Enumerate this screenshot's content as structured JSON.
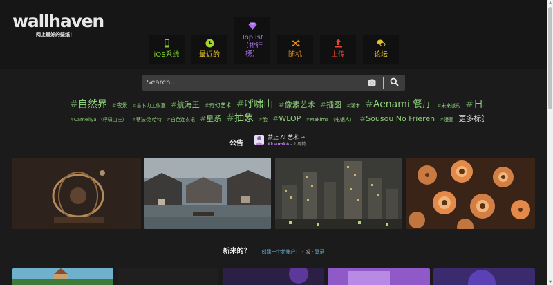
{
  "logo": {
    "text": "wallhaven",
    "tagline": "网上最好的壁纸！"
  },
  "nav": [
    {
      "label": "iOS系统",
      "icon": "phone-icon",
      "color": "#7fcf2f"
    },
    {
      "label": "最近的",
      "icon": "clock-icon",
      "color": "#e2c12c"
    },
    {
      "label": "Toplist\n（排行\n榜）",
      "icon": "gem-icon",
      "color": "#a971f0"
    },
    {
      "label": "随机",
      "icon": "shuffle-icon",
      "color": "#e9902c"
    },
    {
      "label": "上传",
      "icon": "upload-icon",
      "color": "#e5472f"
    },
    {
      "label": "论坛",
      "icon": "chat-icon",
      "color": "#e2c12c"
    }
  ],
  "search": {
    "placeholder": "Search...",
    "value": ""
  },
  "tags_row1": [
    {
      "text": "自然界",
      "size": "s1"
    },
    {
      "text": "夜景",
      "size": "s3"
    },
    {
      "text": "吉卜力工作室",
      "size": "s4"
    },
    {
      "text": "航海王",
      "size": "s2"
    },
    {
      "text": "奇幻艺术",
      "size": "s3"
    },
    {
      "text": "呼啸山",
      "size": "s1"
    },
    {
      "text": "像素艺术",
      "size": "s2"
    },
    {
      "text": "插图",
      "size": "s2"
    },
    {
      "text": "灌木",
      "size": "s4"
    },
    {
      "text": "Aenami 餐厅",
      "size": "s1"
    },
    {
      "text": "未来派的",
      "size": "s4"
    },
    {
      "text": "日本",
      "size": "s1"
    }
  ],
  "tags_row2": [
    {
      "text": "Camellya （呼啸山庄）",
      "size": "s4"
    },
    {
      "text": "蒂法·洛哈特",
      "size": "s4"
    },
    {
      "text": "白色连衣裙",
      "size": "s4"
    },
    {
      "text": "星系",
      "size": "s2"
    },
    {
      "text": "抽象",
      "size": "s1"
    },
    {
      "text": "脸",
      "size": "s4"
    },
    {
      "text": "WLOP",
      "size": "s2"
    },
    {
      "text": "Makima （电锯人）",
      "size": "s4"
    },
    {
      "text": "Sousou No Frieren",
      "size": "s2"
    },
    {
      "text": "漫画",
      "size": "s4"
    }
  ],
  "more_tags": "更多标签...",
  "notice": {
    "label": "公告",
    "title": "禁止 AI 艺术",
    "arrow": "→",
    "user": "AksumkA",
    "time": " - 2 周前"
  },
  "new_section": {
    "title": "新来的？",
    "create_link": "创建一个新帐户！",
    "or": " - 或 - ",
    "login_link": "登录"
  },
  "colors": {
    "background": "#1b1b1b",
    "topbar": "#161616",
    "tag": "#8fd07a",
    "link": "#5fb0e0"
  }
}
